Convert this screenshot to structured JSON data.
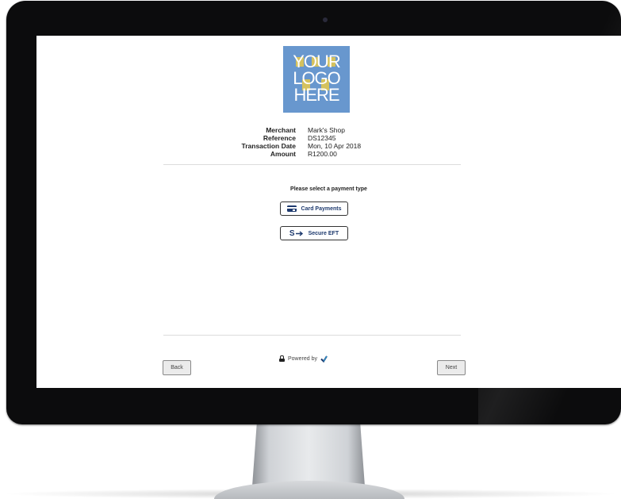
{
  "logo": {
    "text": "YOUR\nLOGO\nHERE",
    "background": "#6897ce",
    "accent": "#e9c94a"
  },
  "details": [
    {
      "label": "Merchant",
      "value": "Mark's Shop"
    },
    {
      "label": "Reference",
      "value": "DS12345"
    },
    {
      "label": "Transaction Date",
      "value": "Mon, 10 Apr 2018"
    },
    {
      "label": "Amount",
      "value": "R1200.00"
    }
  ],
  "payment": {
    "prompt": "Please select a payment type",
    "card_label": "Card Payments",
    "card_icon": "credit-card-icon",
    "eft_label": "Secure EFT",
    "eft_icon": "secure-eft-icon",
    "eft_icon_glyph": "S"
  },
  "footer": {
    "back_label": "Back",
    "next_label": "Next",
    "powered_label": "Powered by",
    "lock_icon": "lock-icon",
    "brand_icon": "brand-checkmark-icon"
  },
  "colors": {
    "brand_navy": "#1e3a6e",
    "bezel": "#0c0c0d"
  }
}
